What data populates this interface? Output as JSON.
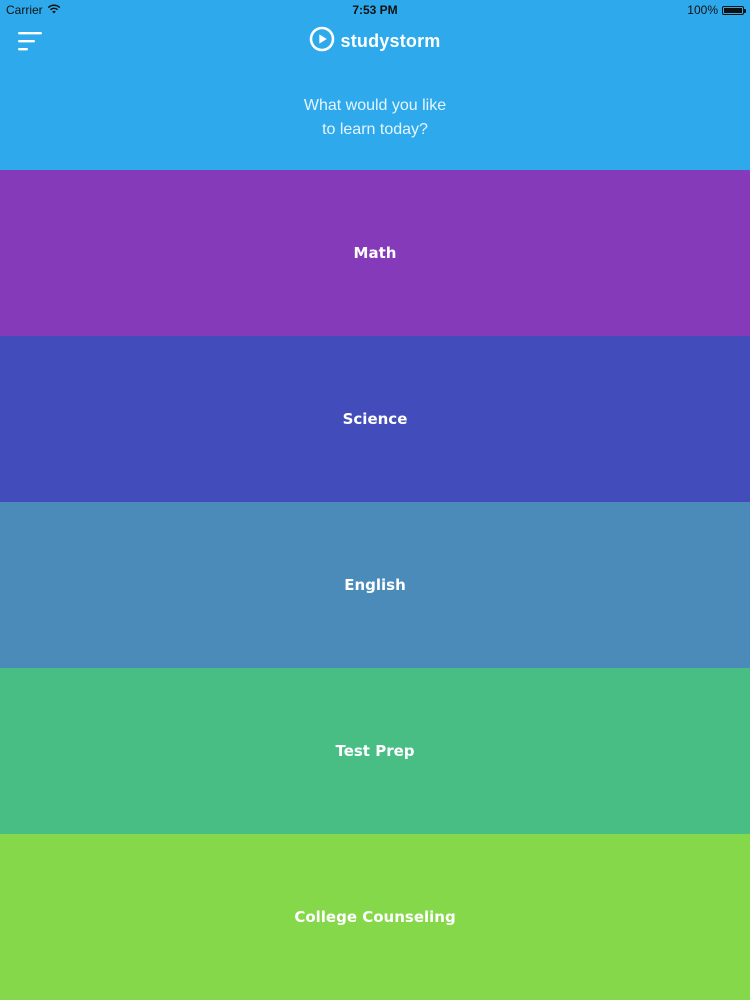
{
  "status_bar": {
    "carrier": "Carrier",
    "time": "7:53 PM",
    "battery": "100%",
    "battery_level": 1.0
  },
  "header": {
    "logo_text": "studystorm",
    "prompt": "What would you like\nto learn today?"
  },
  "categories": [
    {
      "label": "Math",
      "color": "#843ab9"
    },
    {
      "label": "Science",
      "color": "#424cba"
    },
    {
      "label": "English",
      "color": "#4a8bba"
    },
    {
      "label": "Test Prep",
      "color": "#48be85"
    },
    {
      "label": "College Counseling",
      "color": "#86d84b"
    }
  ],
  "icons": {
    "menu": "hamburger-menu-icon",
    "logo": "play-circle-icon",
    "signal": "wifi-icon",
    "battery": "battery-icon"
  },
  "colors": {
    "header_background": "#2eaaec"
  }
}
